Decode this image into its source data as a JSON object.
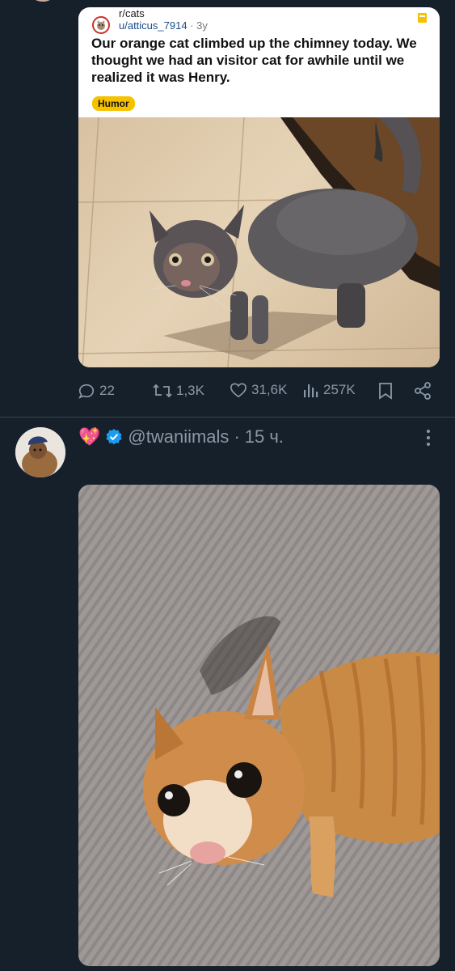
{
  "reddit_post": {
    "subreddit": "r/cats",
    "username": "u/atticus_7914",
    "separator": "·",
    "age": "3y",
    "title": "Our orange cat climbed up the chimney today. We thought we had an visitor cat for awhile until we realized it was Henry.",
    "flair": "Humor",
    "flair_color": "#f6c200"
  },
  "actions": {
    "replies": "22",
    "reposts": "1,3K",
    "likes": "31,6K",
    "views": "257K"
  },
  "tweet": {
    "handle": "@twaniimals",
    "separator": "·",
    "time": "15 ч.",
    "verified_color": "#1d9bf0",
    "emoji": "💖"
  },
  "icons": [
    "reply-icon",
    "repost-icon",
    "like-icon",
    "views-icon",
    "bookmark-icon",
    "share-icon",
    "verified-icon",
    "more-icon",
    "sparkling-heart-icon"
  ],
  "colors": {
    "background": "#15202b",
    "secondary_text": "#8b98a5",
    "divider": "#38444d"
  }
}
